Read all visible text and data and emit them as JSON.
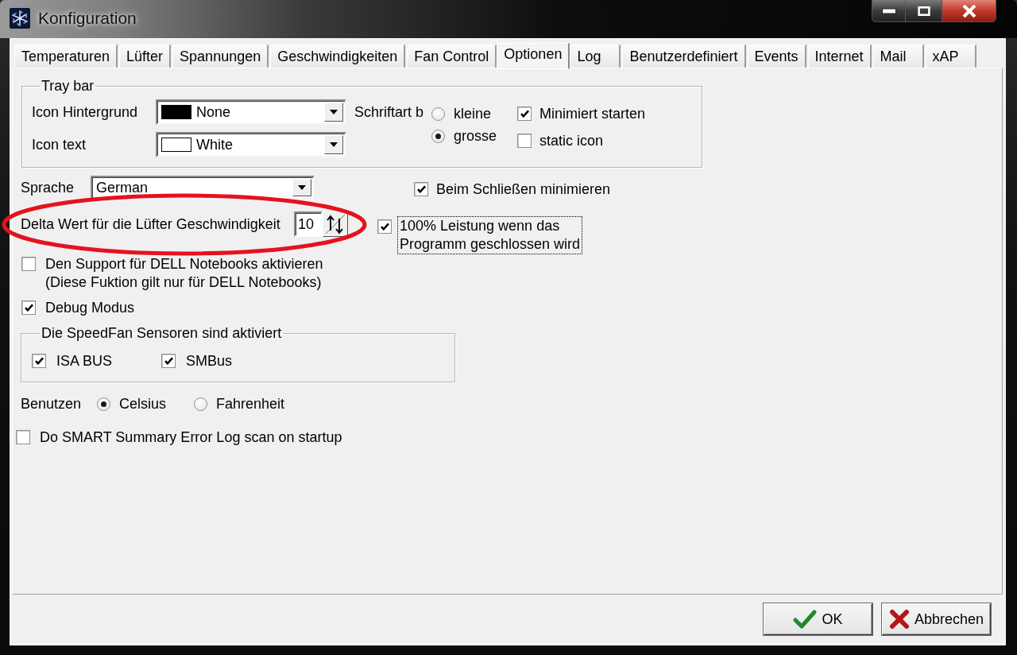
{
  "window": {
    "title": "Konfiguration"
  },
  "tabs": [
    {
      "label": "Temperaturen",
      "selected": false
    },
    {
      "label": "Lüfter",
      "selected": false
    },
    {
      "label": "Spannungen",
      "selected": false
    },
    {
      "label": "Geschwindigkeiten",
      "selected": false
    },
    {
      "label": "Fan Control",
      "selected": false
    },
    {
      "label": "Optionen",
      "selected": true
    },
    {
      "label": "Log",
      "selected": false
    },
    {
      "label": "Benutzerdefiniert",
      "selected": false
    },
    {
      "label": "Events",
      "selected": false
    },
    {
      "label": "Internet",
      "selected": false
    },
    {
      "label": "Mail",
      "selected": false
    },
    {
      "label": "xAP",
      "selected": false
    }
  ],
  "tray_bar": {
    "title": "Tray bar",
    "rows": [
      {
        "label": "Icon Hintergrund",
        "value": "None",
        "color": "#000000"
      },
      {
        "label": "Icon text",
        "value": "White",
        "color": "#ffffff"
      }
    ],
    "font_size": {
      "label": "Schriftart b",
      "options": [
        {
          "label": "kleine",
          "selected": false
        },
        {
          "label": "grosse",
          "selected": true
        }
      ]
    },
    "checkboxes": [
      {
        "label": "Minimiert starten",
        "checked": true
      },
      {
        "label": "static icon",
        "checked": false
      }
    ]
  },
  "language": {
    "label": "Sprache",
    "value": "German"
  },
  "minimize_on_close": {
    "label": "Beim Schließen minimieren",
    "checked": true
  },
  "delta": {
    "label": "Delta Wert für die Lüfter Geschwindigkeit",
    "value": "10",
    "highlighted": true
  },
  "full_power_on_close": {
    "lines": [
      "100% Leistung wenn das",
      "Programm geschlossen wird"
    ],
    "checked": true,
    "focused": true
  },
  "dell_support": {
    "label": "Den Support für DELL Notebooks aktivieren",
    "note": "(Diese Fuktion gilt nur für DELL Notebooks)",
    "checked": false
  },
  "debug_mode": {
    "label": "Debug Modus",
    "checked": true
  },
  "sensors": {
    "title": "Die SpeedFan Sensoren sind aktiviert",
    "items": [
      {
        "label": "ISA BUS",
        "checked": true
      },
      {
        "label": "SMBus",
        "checked": true
      }
    ]
  },
  "units": {
    "label": "Benutzen",
    "options": [
      {
        "label": "Celsius",
        "selected": true
      },
      {
        "label": "Fahrenheit",
        "selected": false
      }
    ]
  },
  "smart_scan": {
    "label": "Do SMART Summary Error Log scan on startup",
    "checked": false
  },
  "buttons": [
    {
      "label": "OK",
      "kind": "ok"
    },
    {
      "label": "Abbrechen",
      "kind": "cancel"
    }
  ]
}
